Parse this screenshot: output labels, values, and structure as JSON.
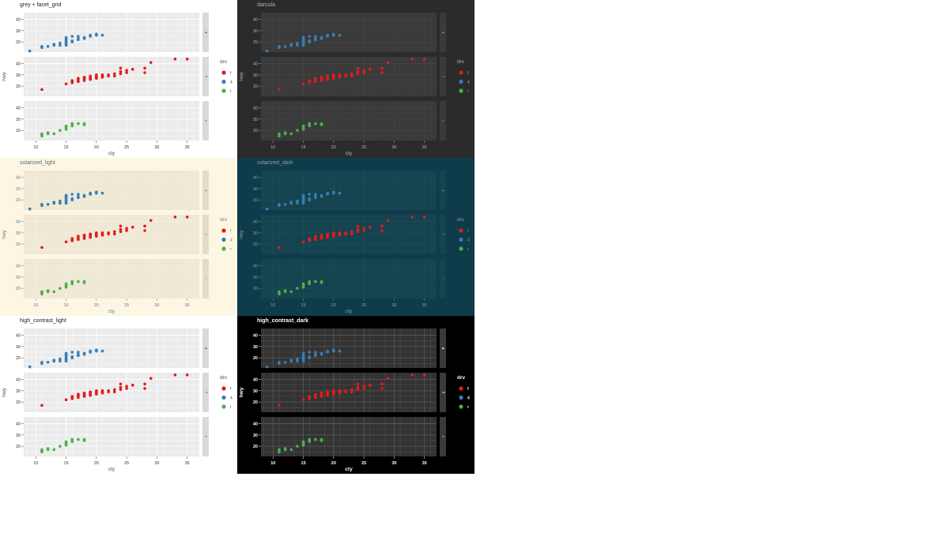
{
  "colors": {
    "f": "#E41A1C",
    "4": "#377EB8",
    "r": "#4DAF4A"
  },
  "chart_data": [
    {
      "type": "scatter",
      "title": "grey + facet_grid",
      "xlabel": "cty",
      "ylabel": "hwy",
      "facets": [
        "4",
        "f",
        "r"
      ],
      "xlim": [
        8,
        37
      ],
      "ylim": [
        11,
        46
      ],
      "xticks": [
        10,
        15,
        20,
        25,
        30,
        35
      ],
      "yticks": [
        20,
        30,
        40
      ],
      "legend": {
        "title": "drv",
        "entries": [
          "f",
          "4",
          "r"
        ],
        "position": "right"
      },
      "grid": true,
      "theme": {
        "bg": "#ffffff",
        "panel": "#EBEBEB",
        "grid": "#ffffff",
        "strip": "#D9D9D9",
        "stripText": "#1A1A1A",
        "text": "#4D4D4D",
        "title": "#1A1A1A",
        "tick": "#333333"
      }
    },
    {
      "type": "scatter",
      "title": "darcula",
      "xlabel": "cty",
      "ylabel": "hwy",
      "facets": [
        "4",
        "f",
        "r"
      ],
      "xlim": [
        8,
        37
      ],
      "ylim": [
        11,
        46
      ],
      "xticks": [
        10,
        15,
        20,
        25,
        30,
        35
      ],
      "yticks": [
        20,
        30,
        40
      ],
      "legend": {
        "title": "drv",
        "entries": [
          "f",
          "4",
          "r"
        ],
        "position": "right"
      },
      "grid": true,
      "theme": {
        "bg": "#2B2B2B",
        "panel": "#3A3A3A",
        "grid": "#454545",
        "strip": "#3A3A3A",
        "stripText": "#BBBBBB",
        "text": "#A9B7C6",
        "title": "#A9B7C6",
        "tick": "#A9B7C6"
      }
    },
    {
      "type": "scatter",
      "title": "solarized_light",
      "xlabel": "cty",
      "ylabel": "hwy",
      "facets": [
        "4",
        "f",
        "r"
      ],
      "xlim": [
        8,
        37
      ],
      "ylim": [
        11,
        46
      ],
      "xticks": [
        10,
        15,
        20,
        25,
        30,
        35
      ],
      "yticks": [
        20,
        30,
        40
      ],
      "legend": {
        "title": "drv",
        "entries": [
          "f",
          "4",
          "r"
        ],
        "position": "right"
      },
      "grid": true,
      "theme": {
        "bg": "#FDF6E3",
        "panel": "#EEE8D5",
        "grid": "#F6F0DE",
        "strip": "#E4DCC6",
        "stripText": "#657B83",
        "text": "#657B83",
        "title": "#586E75",
        "tick": "#657B83"
      }
    },
    {
      "type": "scatter",
      "title": "solarized_dark",
      "xlabel": "cty",
      "ylabel": "hwy",
      "facets": [
        "4",
        "f",
        "r"
      ],
      "xlim": [
        8,
        37
      ],
      "ylim": [
        11,
        46
      ],
      "xticks": [
        10,
        15,
        20,
        25,
        30,
        35
      ],
      "yticks": [
        20,
        30,
        40
      ],
      "legend": {
        "title": "drv",
        "entries": [
          "f",
          "4",
          "r"
        ],
        "position": "right"
      },
      "grid": true,
      "theme": {
        "bg": "#0E3C4B",
        "panel": "#15434F",
        "grid": "#1F4D59",
        "strip": "#15434F",
        "stripText": "#93A1A1",
        "text": "#93A1A1",
        "title": "#93A1A1",
        "tick": "#93A1A1"
      }
    },
    {
      "type": "scatter",
      "title": "high_contrast_light",
      "xlabel": "cty",
      "ylabel": "hwy",
      "facets": [
        "4",
        "f",
        "r"
      ],
      "xlim": [
        8,
        37
      ],
      "ylim": [
        11,
        46
      ],
      "xticks": [
        10,
        15,
        20,
        25,
        30,
        35
      ],
      "yticks": [
        20,
        30,
        40
      ],
      "legend": {
        "title": "drv",
        "entries": [
          "f",
          "4",
          "r"
        ],
        "position": "right"
      },
      "grid": true,
      "theme": {
        "bg": "#ffffff",
        "panel": "#EBEBEB",
        "grid": "#ffffff",
        "strip": "#D9D9D9",
        "stripText": "#1A1A1A",
        "text": "#4D4D4D",
        "title": "#1A1A1A",
        "tick": "#333333"
      }
    },
    {
      "type": "scatter",
      "title": "high_contrast_dark",
      "xlabel": "cty",
      "ylabel": "hwy",
      "facets": [
        "4",
        "f",
        "r"
      ],
      "xlim": [
        8,
        37
      ],
      "ylim": [
        11,
        46
      ],
      "xticks": [
        10,
        15,
        20,
        25,
        30,
        35
      ],
      "yticks": [
        20,
        30,
        40
      ],
      "legend": {
        "title": "drv",
        "entries": [
          "f",
          "4",
          "r"
        ],
        "position": "right"
      },
      "grid": true,
      "theme": {
        "bg": "#000000",
        "panel": "#333333",
        "grid": "#5A5A5A",
        "strip": "#3A3A3A",
        "stripText": "#FFFFFF",
        "text": "#FFFFFF",
        "title": "#FFFFFF",
        "tick": "#FFFFFF"
      }
    }
  ],
  "series": {
    "4": [
      [
        9,
        12
      ],
      [
        11,
        15
      ],
      [
        11,
        16
      ],
      [
        12,
        16
      ],
      [
        13,
        17
      ],
      [
        13,
        18
      ],
      [
        14,
        17
      ],
      [
        14,
        19
      ],
      [
        15,
        17
      ],
      [
        15,
        18
      ],
      [
        15,
        19
      ],
      [
        15,
        20
      ],
      [
        15,
        21
      ],
      [
        15,
        22
      ],
      [
        15,
        23
      ],
      [
        15,
        24
      ],
      [
        16,
        20
      ],
      [
        16,
        21
      ],
      [
        16,
        25
      ],
      [
        17,
        22
      ],
      [
        17,
        23
      ],
      [
        17,
        25
      ],
      [
        18,
        23
      ],
      [
        18,
        24
      ],
      [
        19,
        25
      ],
      [
        19,
        26
      ],
      [
        20,
        26
      ],
      [
        20,
        27
      ],
      [
        21,
        26
      ]
    ],
    "f": [
      [
        11,
        17
      ],
      [
        15,
        22
      ],
      [
        16,
        23
      ],
      [
        16,
        24
      ],
      [
        16,
        25
      ],
      [
        17,
        24
      ],
      [
        17,
        25
      ],
      [
        17,
        26
      ],
      [
        17,
        27
      ],
      [
        18,
        25
      ],
      [
        18,
        26
      ],
      [
        18,
        27
      ],
      [
        18,
        28
      ],
      [
        19,
        26
      ],
      [
        19,
        27
      ],
      [
        19,
        28
      ],
      [
        19,
        29
      ],
      [
        20,
        27
      ],
      [
        20,
        28
      ],
      [
        20,
        29
      ],
      [
        20,
        30
      ],
      [
        21,
        28
      ],
      [
        21,
        29
      ],
      [
        21,
        30
      ],
      [
        22,
        29
      ],
      [
        22,
        30
      ],
      [
        23,
        29
      ],
      [
        23,
        31
      ],
      [
        24,
        31
      ],
      [
        24,
        33
      ],
      [
        24,
        36
      ],
      [
        25,
        32
      ],
      [
        25,
        34
      ],
      [
        26,
        35
      ],
      [
        28,
        32
      ],
      [
        28,
        36
      ],
      [
        29,
        41
      ],
      [
        33,
        44
      ],
      [
        35,
        44
      ]
    ],
    "r": [
      [
        11,
        15
      ],
      [
        11,
        16
      ],
      [
        11,
        17
      ],
      [
        12,
        18
      ],
      [
        12,
        17
      ],
      [
        13,
        17
      ],
      [
        14,
        20
      ],
      [
        15,
        22
      ],
      [
        15,
        23
      ],
      [
        15,
        24
      ],
      [
        15,
        21
      ],
      [
        16,
        24
      ],
      [
        16,
        25
      ],
      [
        16,
        26
      ],
      [
        17,
        26
      ],
      [
        18,
        25
      ],
      [
        18,
        26
      ]
    ]
  }
}
